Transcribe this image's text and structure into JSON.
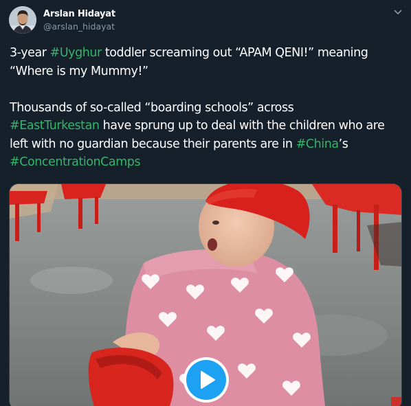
{
  "author": {
    "display_name": "Arslan Hidayat",
    "handle": "@arslan_hidayat"
  },
  "tweet": {
    "lines": [
      [
        {
          "text": "3-year ",
          "tag": false
        },
        {
          "text": "#Uyghur",
          "tag": true
        },
        {
          "text": " toddler screaming out “APAM QENI!” meaning",
          "tag": false
        }
      ],
      [
        {
          "text": "“Where is my Mummy!”",
          "tag": false
        }
      ],
      [],
      [
        {
          "text": "Thousands of so-called “boarding schools” across",
          "tag": false
        }
      ],
      [
        {
          "text": "#EastTurkestan",
          "tag": true
        },
        {
          "text": " have sprung up to deal with the children who are",
          "tag": false
        }
      ],
      [
        {
          "text": "left with no guardian because their parents are in ",
          "tag": false
        },
        {
          "text": "#China",
          "tag": true
        },
        {
          "text": "’s",
          "tag": false
        }
      ],
      [
        {
          "text": "#ConcentrationCamps",
          "tag": true
        }
      ]
    ]
  },
  "media": {
    "type": "video",
    "play_icon": "play-icon"
  },
  "colors": {
    "background": "#15202b",
    "text": "#ffffff",
    "secondary_text": "#8899a6",
    "hashtag": "#36b36b",
    "play_button": "#1da1f2"
  },
  "icons": {
    "menu": "chevron-down-icon",
    "avatar": "avatar"
  }
}
